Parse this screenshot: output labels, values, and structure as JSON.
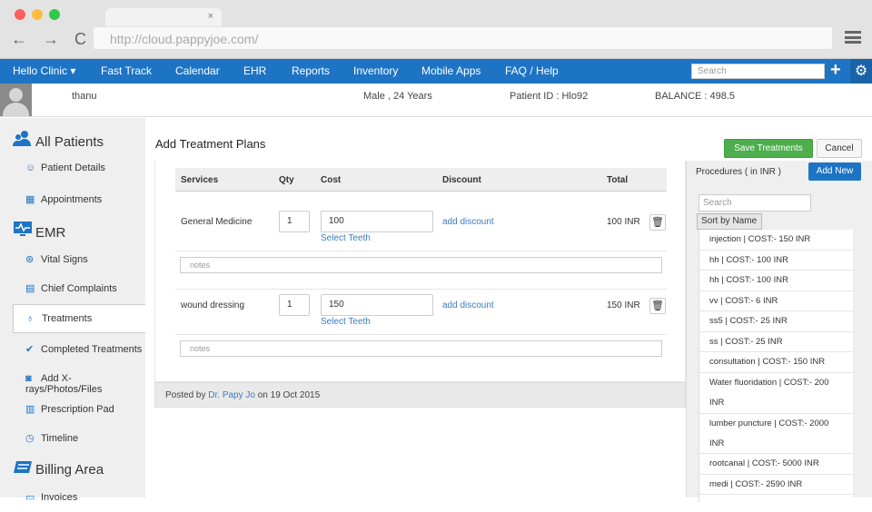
{
  "browser": {
    "url": "http://cloud.pappyjoe.com/",
    "tab_close": "×",
    "nav_glyphs": "← → C",
    "traffic_colors": [
      "#fc605b",
      "#fdbc40",
      "#34c84a"
    ]
  },
  "topnav": {
    "brand": "Hello Clinic ▾",
    "items": [
      "Fast Track",
      "Calendar",
      "EHR",
      "Reports",
      "Inventory",
      "Mobile Apps",
      "FAQ / Help"
    ],
    "search_placeholder": "Search",
    "plus": "+",
    "gear": "⚙"
  },
  "patient": {
    "name": "thanu",
    "gender_age": "Male , 24 Years",
    "patient_id": "Patient ID : Hlo92",
    "balance": "BALANCE :  498.5"
  },
  "sidebar": {
    "sections": [
      "All Patients",
      "EMR",
      "Billing Area"
    ],
    "items": [
      "Patient Details",
      "Appointments",
      "Vital Signs",
      "Chief Complaints",
      "Treatments",
      "Completed Treatments",
      "Add X-rays/Photos/Files",
      "Prescription Pad",
      "Timeline",
      "Invoices"
    ]
  },
  "main": {
    "title": "Add Treatment Plans",
    "save_label": "Save Treatments",
    "cancel_label": "Cancel",
    "headers": [
      "Services",
      "Qty",
      "Cost",
      "Discount",
      "Total"
    ],
    "rows": [
      {
        "service": "General Medicine",
        "qty": "1",
        "cost": "100",
        "teeth": "Select Teeth",
        "discount": "add discount",
        "total": "100 INR",
        "notes": "notes"
      },
      {
        "service": "wound dressing",
        "qty": "1",
        "cost": "150",
        "teeth": "Select Teeth",
        "discount": "add discount",
        "total": "150 INR",
        "notes": "notes"
      }
    ],
    "posted_prefix": "Posted by",
    "posted_by": "Dr. Papy Jo",
    "posted_suffix": "on 19 Oct 2015"
  },
  "procedures": {
    "title": "Procedures ( in INR )",
    "add_new": "Add New",
    "search_placeholder": "Search",
    "sort_label": "Sort by Name",
    "items": [
      "injection |   COST:- 150 INR",
      "hh |   COST:- 100 INR",
      "hh |   COST:- 100 INR",
      "vv |   COST:- 6 INR",
      "ss5 |   COST:- 25 INR",
      "ss |   COST:- 25 INR",
      "consultation |   COST:- 150 INR",
      "Water fluoridation |   COST:- 200 INR",
      "lumber puncture |   COST:- 2000 INR",
      "rootcanal |   COST:- 5000 INR",
      "medi |   COST:- 2590 INR"
    ]
  }
}
